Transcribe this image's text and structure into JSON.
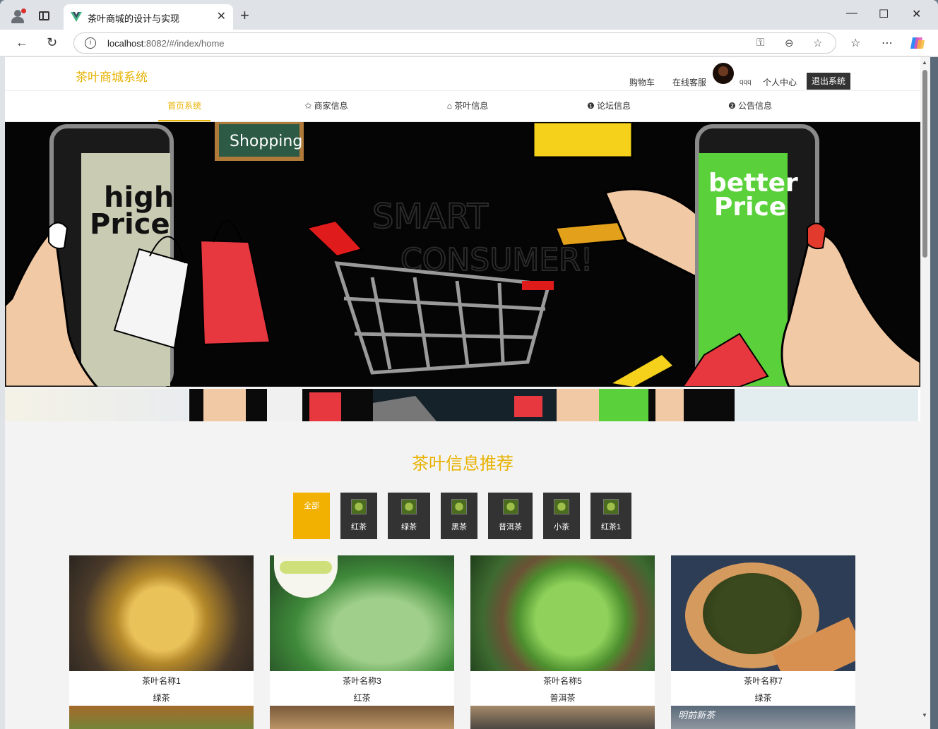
{
  "browser": {
    "tab_title": "茶叶商城的设计与实现",
    "tab_close": "✕",
    "new_tab": "+",
    "url_host": "localhost",
    "url_rest": ":8082/#/index/home",
    "minimize": "—",
    "maximize": "☐",
    "close": "✕"
  },
  "header": {
    "logo": "茶叶商城系统",
    "cart": "购物车",
    "service": "在线客服",
    "username": "qqq",
    "center": "个人中心",
    "logout": "退出系统"
  },
  "menu": [
    {
      "label": "首页系统",
      "active": true
    },
    {
      "label": "✩ 商家信息"
    },
    {
      "label": "⌂ 茶叶信息"
    },
    {
      "label": "❶ 论坛信息"
    },
    {
      "label": "❷ 公告信息"
    }
  ],
  "banner": {
    "left_phone_text": [
      "high",
      "Price"
    ],
    "right_phone_text": [
      "better",
      "Price"
    ],
    "sign": "Shopping",
    "center_text": [
      "SMART",
      "CONSUMER!"
    ]
  },
  "section": {
    "title": "茶叶信息推荐"
  },
  "categories": [
    "全部",
    "红茶",
    "绿茶",
    "黑茶",
    "普洱茶",
    "小茶",
    "红茶1"
  ],
  "products": [
    {
      "name": "茶叶名称1",
      "type": "绿茶"
    },
    {
      "name": "茶叶名称3",
      "type": "红茶"
    },
    {
      "name": "茶叶名称5",
      "type": "普洱茶"
    },
    {
      "name": "茶叶名称7",
      "type": "绿茶"
    }
  ],
  "second_row_caption": "明前新茶",
  "colors": {
    "accent": "#e8b200",
    "category_bg": "#333333",
    "category_active": "#f2b100"
  }
}
